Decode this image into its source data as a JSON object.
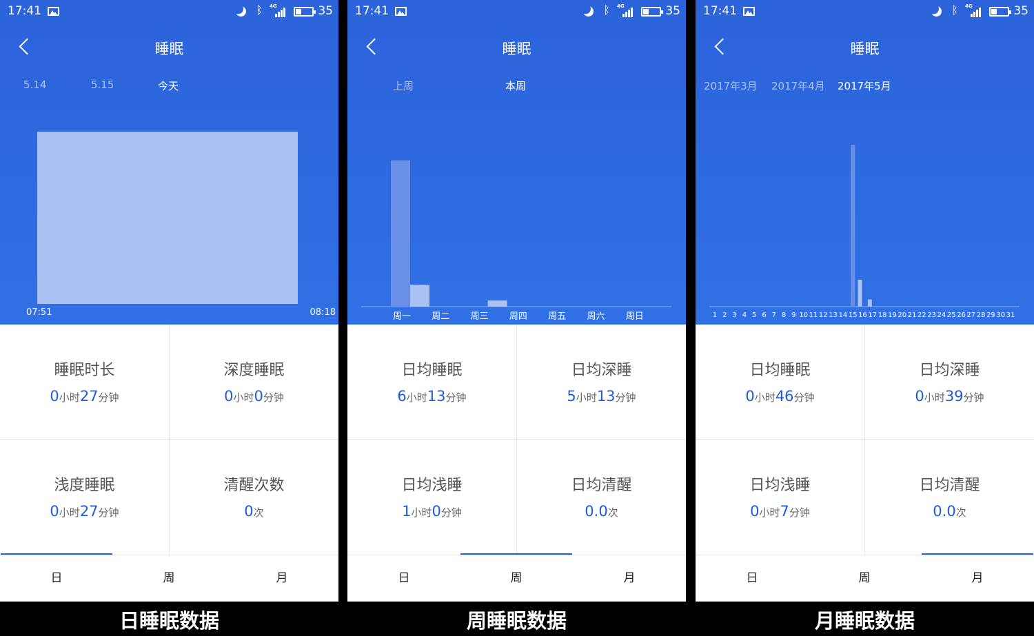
{
  "colors": {
    "header_bg": "#2c63da",
    "accent": "#1f5ad7",
    "bar_fill": "#a9c1f3"
  },
  "panels": [
    {
      "status": {
        "time": "17:41",
        "battery": "35"
      },
      "title": "睡眠",
      "periods": [
        "5.14",
        "5.15",
        "今天"
      ],
      "active_period": 2,
      "stats": [
        {
          "label": "睡眠时长",
          "v1": "0",
          "u1": "小时",
          "v2": "27",
          "u2": "分钟"
        },
        {
          "label": "深度睡眠",
          "v1": "0",
          "u1": "小时",
          "v2": "0",
          "u2": "分钟"
        },
        {
          "label": "浅度睡眠",
          "v1": "0",
          "u1": "小时",
          "v2": "27",
          "u2": "分钟"
        },
        {
          "label": "清醒次数",
          "v1": "0",
          "u1": "次",
          "v2": "",
          "u2": ""
        }
      ],
      "tabs": [
        "日",
        "周",
        "月"
      ],
      "active_tab": 0,
      "caption": "日睡眠数据"
    },
    {
      "status": {
        "time": "17:41",
        "battery": "35"
      },
      "title": "睡眠",
      "periods": [
        "上周",
        "本周"
      ],
      "active_period": 1,
      "stats": [
        {
          "label": "日均睡眠",
          "v1": "6",
          "u1": "小时",
          "v2": "13",
          "u2": "分钟"
        },
        {
          "label": "日均深睡",
          "v1": "5",
          "u1": "小时",
          "v2": "13",
          "u2": "分钟"
        },
        {
          "label": "日均浅睡",
          "v1": "1",
          "u1": "小时",
          "v2": "0",
          "u2": "分钟"
        },
        {
          "label": "日均清醒",
          "v1": "0.0",
          "u1": "次",
          "v2": "",
          "u2": ""
        }
      ],
      "tabs": [
        "日",
        "周",
        "月"
      ],
      "active_tab": 1,
      "caption": "周睡眠数据"
    },
    {
      "status": {
        "time": "17:41",
        "battery": "35"
      },
      "title": "睡眠",
      "periods": [
        "2017年3月",
        "2017年4月",
        "2017年5月"
      ],
      "active_period": 2,
      "stats": [
        {
          "label": "日均睡眠",
          "v1": "0",
          "u1": "小时",
          "v2": "46",
          "u2": "分钟"
        },
        {
          "label": "日均深睡",
          "v1": "0",
          "u1": "小时",
          "v2": "39",
          "u2": "分钟"
        },
        {
          "label": "日均浅睡",
          "v1": "0",
          "u1": "小时",
          "v2": "7",
          "u2": "分钟"
        },
        {
          "label": "日均清醒",
          "v1": "0.0",
          "u1": "次",
          "v2": "",
          "u2": ""
        }
      ],
      "tabs": [
        "日",
        "周",
        "月"
      ],
      "active_tab": 2,
      "caption": "月睡眠数据"
    }
  ],
  "chart_data": [
    {
      "type": "bar",
      "categories": [
        "07:51",
        "08:18"
      ],
      "segments": [
        {
          "start": "07:51",
          "end": "08:18",
          "level": 0.83
        }
      ]
    },
    {
      "type": "bar",
      "categories": [
        "周一",
        "周二",
        "周三",
        "周四",
        "周五",
        "周六",
        "周日"
      ],
      "series": [
        {
          "values": [
            5.22,
            0,
            0,
            0,
            0,
            0,
            0
          ]
        },
        {
          "values": [
            0.78,
            0,
            0.22,
            0,
            0,
            0,
            0
          ]
        }
      ]
    },
    {
      "type": "bar",
      "categories": [
        "1",
        "2",
        "3",
        "4",
        "5",
        "6",
        "7",
        "8",
        "9",
        "10",
        "11",
        "12",
        "13",
        "14",
        "15",
        "16",
        "17",
        "18",
        "19",
        "20",
        "21",
        "22",
        "23",
        "24",
        "25",
        "26",
        "27",
        "28",
        "29",
        "30",
        "31"
      ],
      "series": [
        {
          "values": [
            0,
            0,
            0,
            0,
            0,
            0,
            0,
            0,
            0,
            0,
            0,
            0,
            0,
            0,
            0.9,
            0,
            0,
            0,
            0,
            0,
            0,
            0,
            0,
            0,
            0,
            0,
            0,
            0,
            0,
            0,
            0
          ]
        },
        {
          "values": [
            0,
            0,
            0,
            0,
            0,
            0,
            0,
            0,
            0,
            0,
            0,
            0,
            0,
            0,
            0,
            0.15,
            0.04,
            0,
            0,
            0,
            0,
            0,
            0,
            0,
            0,
            0,
            0,
            0,
            0,
            0,
            0
          ]
        }
      ]
    }
  ]
}
